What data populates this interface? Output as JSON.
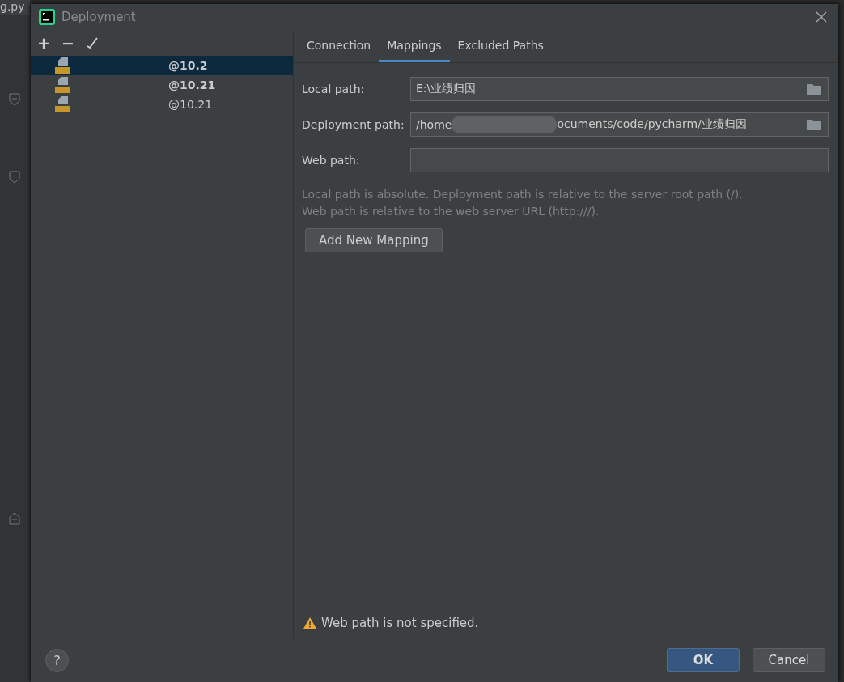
{
  "editor": {
    "tab": "g.py"
  },
  "dialog": {
    "title": "Deployment",
    "toolbar": [
      "+",
      "−"
    ],
    "servers": [
      {
        "name": "@10.2",
        "selected": true,
        "bold": true
      },
      {
        "name": "@10.21",
        "selected": false,
        "bold": true
      },
      {
        "name": "@10.21",
        "selected": false,
        "bold": false
      }
    ],
    "tabs": [
      {
        "label": "Connection",
        "selected": false
      },
      {
        "label": "Mappings",
        "selected": true
      },
      {
        "label": "Excluded Paths",
        "selected": false
      }
    ],
    "fields": [
      {
        "label": "Local path:",
        "value": "E:\\业绩归因",
        "folder": true
      },
      {
        "label": "Deployment path:",
        "value": "/home",
        "value_after_blur": "ocuments/code/pycharm/业绩归因",
        "folder": true
      },
      {
        "label": "Web path:",
        "folder": false
      }
    ],
    "hint": [
      "Local path is absolute. Deployment path is relative to the server root path (/).",
      "Web path is relative to the web server URL (http:///)."
    ],
    "add_button": "Add New Mapping",
    "warning": "Web path is not specified.",
    "help": "?",
    "buttons": [
      {
        "label": "OK",
        "kind": "primary"
      },
      {
        "label": "Cancel",
        "kind": "secondary"
      }
    ]
  }
}
